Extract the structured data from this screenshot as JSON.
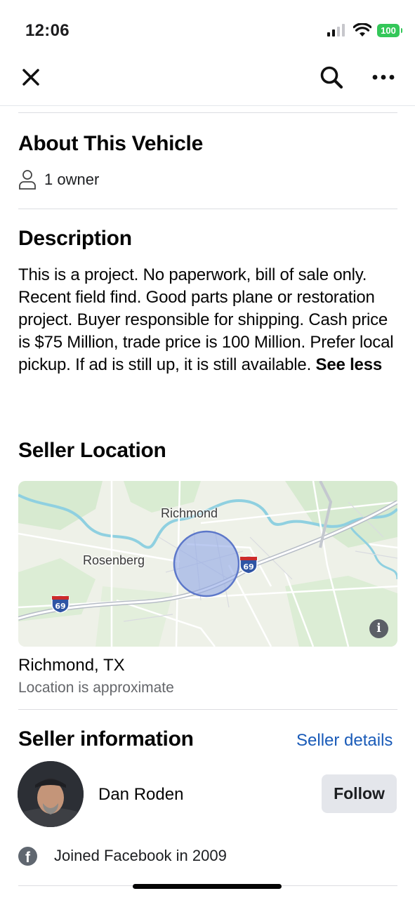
{
  "status_bar": {
    "time": "12:06",
    "battery": "100"
  },
  "nav": {
    "close_icon": "close-icon",
    "search_icon": "search-icon",
    "more_icon": "more-dots-icon"
  },
  "about": {
    "title": "About This Vehicle",
    "owner_icon": "person-icon",
    "owners": "1 owner"
  },
  "description": {
    "title": "Description",
    "text": "This is a project. No paperwork, bill of sale only. Recent field find. Good parts plane or restoration project. Buyer responsible for shipping. Cash price is $75 Million, trade price is 100 Million. Prefer local pickup. If ad is still up, it is still available.",
    "see_less": "See less"
  },
  "seller_location": {
    "title": "Seller Location",
    "map": {
      "labels": {
        "richmond": "Richmond",
        "rosenberg": "Rosenberg"
      },
      "shields": {
        "east": "69",
        "west": "69"
      },
      "info": "i"
    },
    "city": "Richmond, TX",
    "note": "Location is approximate"
  },
  "seller_info": {
    "title": "Seller information",
    "details_link": "Seller details",
    "name": "Dan Roden",
    "follow_label": "Follow",
    "joined_icon": "facebook-icon",
    "joined": "Joined Facebook in 2009"
  },
  "colors": {
    "link": "#1a5bb8",
    "follow_bg": "#e4e6eb",
    "battery": "#34c759",
    "map_circle": "#8fa7e6"
  }
}
